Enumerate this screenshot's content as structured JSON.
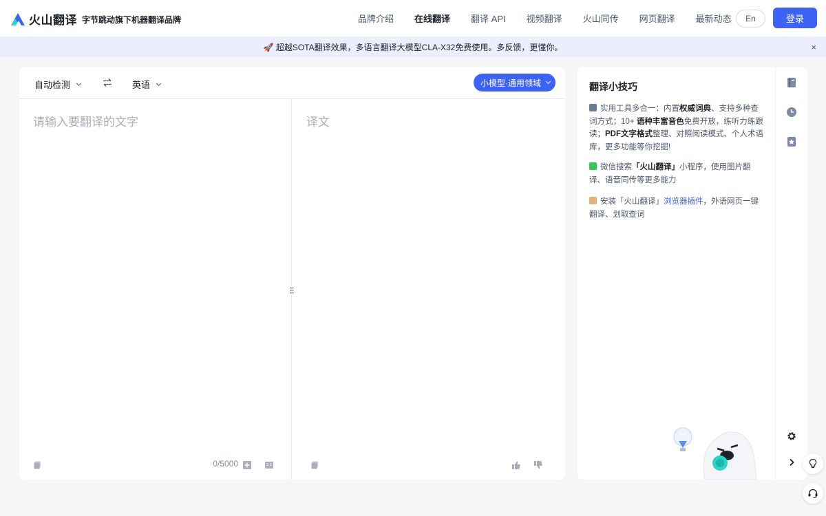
{
  "header": {
    "logo_text": "火山翻译",
    "slogan": "字节跳动旗下机器翻译品牌",
    "nav": [
      "品牌介绍",
      "在线翻译",
      "翻译 API",
      "视频翻译",
      "火山同传",
      "网页翻译",
      "最新动态"
    ],
    "active_nav": "在线翻译",
    "lang_switch": "En",
    "login": "登录"
  },
  "banner": {
    "text": "🚀 超越SOTA翻译效果，多语言翻译大模型CLA-X32免费使用。多反馈，更懂你。",
    "close": "×"
  },
  "translator": {
    "source_lang": "自动检测",
    "target_lang": "英语",
    "model": "小模型·通用领域",
    "input_placeholder": "请输入要翻译的文字",
    "output_placeholder": "译文",
    "char_count": "0/5000"
  },
  "tips": {
    "title": "翻译小技巧",
    "tip1": {
      "p1": "实用工具多合一：内置",
      "b1": "权威词典",
      "p2": "、支持多种查词方式；10+ ",
      "b2": "语种丰富音色",
      "p3": "免费开放，练听力练跟读；",
      "b3": "PDF文字格式",
      "p4": "整理、对照阅读模式、个人术语库，更多功能等你挖掘!"
    },
    "tip2": {
      "p1": "微信搜索",
      "b1": "「火山翻译」",
      "p2": "小程序，使用图片翻译、语音同传等更多能力"
    },
    "tip3": {
      "p1": "安装「火山翻译」",
      "link": "浏览器插件",
      "p2": "，外语网页一键翻译、划取查词"
    }
  },
  "colors": {
    "accent": "#3c63f5",
    "banner_bg": "#eceefc",
    "page_bg": "#f5f6f8"
  },
  "icons": [
    "swap-icon",
    "copy-icon",
    "add-icon",
    "dictionary-icon",
    "like-icon",
    "dislike-icon",
    "book-icon",
    "history-icon",
    "favorite-icon",
    "settings-icon",
    "chevron-right-icon",
    "lightbulb-icon",
    "headset-icon"
  ]
}
